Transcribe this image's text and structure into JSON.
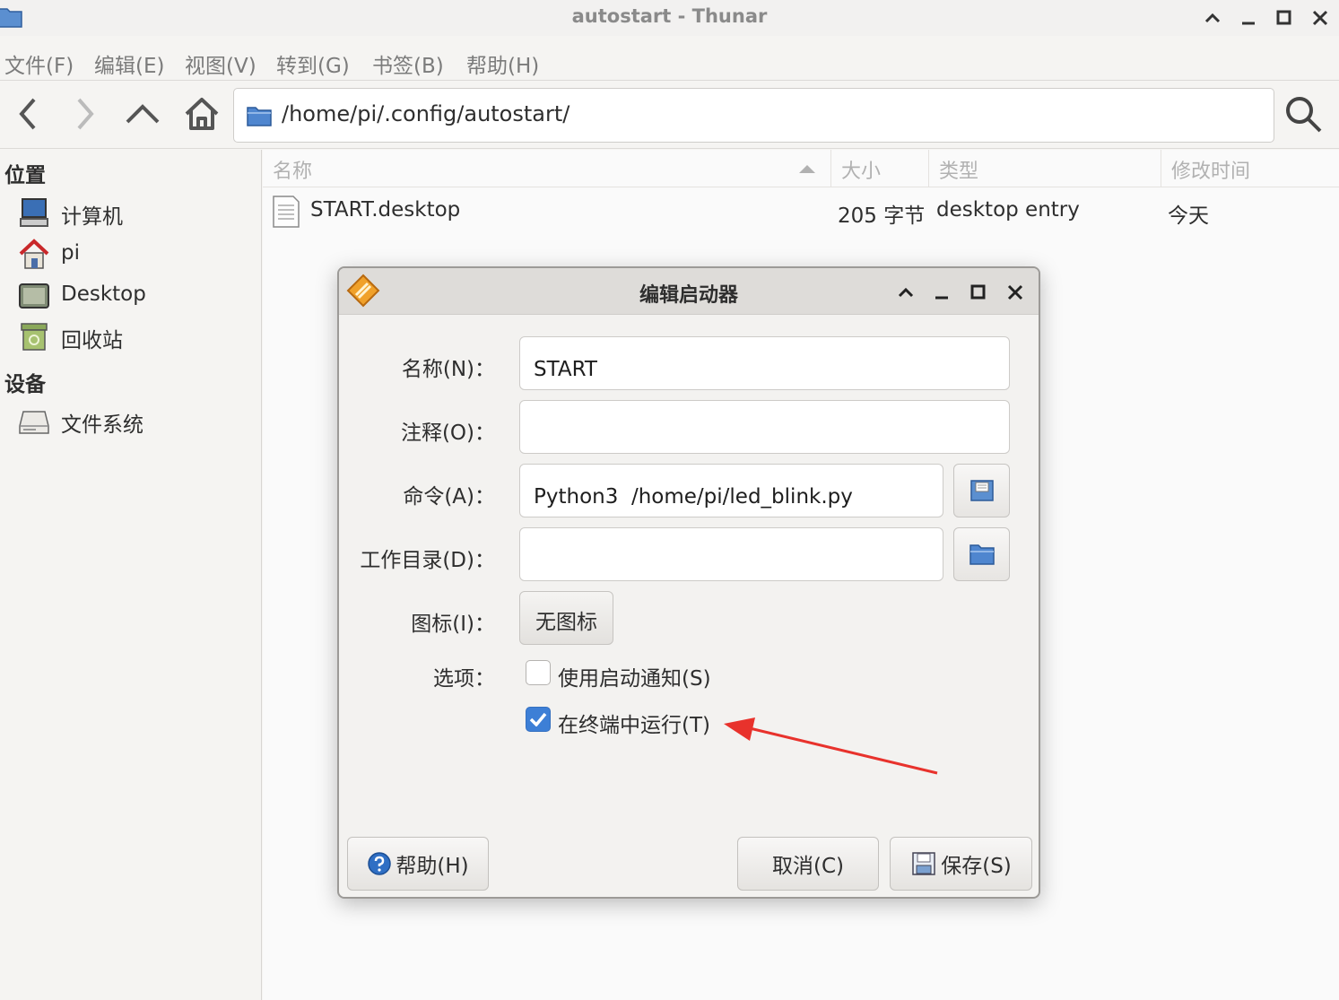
{
  "window": {
    "title": "autostart - Thunar"
  },
  "menu": [
    "文件(F)",
    "编辑(E)",
    "视图(V)",
    "转到(G)",
    "书签(B)",
    "帮助(H)"
  ],
  "toolbar": {
    "path": "/home/pi/.config/autostart/"
  },
  "sidebar": {
    "places_heading": "位置",
    "places": [
      {
        "label": "计算机",
        "icon": "computer-icon"
      },
      {
        "label": "pi",
        "icon": "home-icon"
      },
      {
        "label": "Desktop",
        "icon": "desktop-icon"
      },
      {
        "label": "回收站",
        "icon": "trash-icon"
      }
    ],
    "devices_heading": "设备",
    "devices": [
      {
        "label": "文件系统",
        "icon": "drive-icon"
      }
    ]
  },
  "filelist": {
    "columns": [
      "名称",
      "大小",
      "类型",
      "修改时间"
    ],
    "rows": [
      {
        "name": "START.desktop",
        "size": "205 字节",
        "type": "desktop entry",
        "modified": "今天"
      }
    ]
  },
  "dialog": {
    "title": "编辑启动器",
    "name_label": "名称(N)：",
    "name_value": "START",
    "comment_label": "注释(O)：",
    "comment_value": "",
    "command_label": "命令(A)：",
    "command_value": "Python3  /home/pi/led_blink.py",
    "workdir_label": "工作目录(D)：",
    "workdir_value": "",
    "icon_label": "图标(I)：",
    "icon_button": "无图标",
    "options_label": "选项：",
    "option_notify": "使用启动通知(S)",
    "option_notify_checked": false,
    "option_terminal": "在终端中运行(T)",
    "option_terminal_checked": true,
    "help_button": "帮助(H)",
    "cancel_button": "取消(C)",
    "save_button": "保存(S)"
  },
  "colors": {
    "accent": "#3d7fd6",
    "annotation_arrow": "#e8322c"
  }
}
